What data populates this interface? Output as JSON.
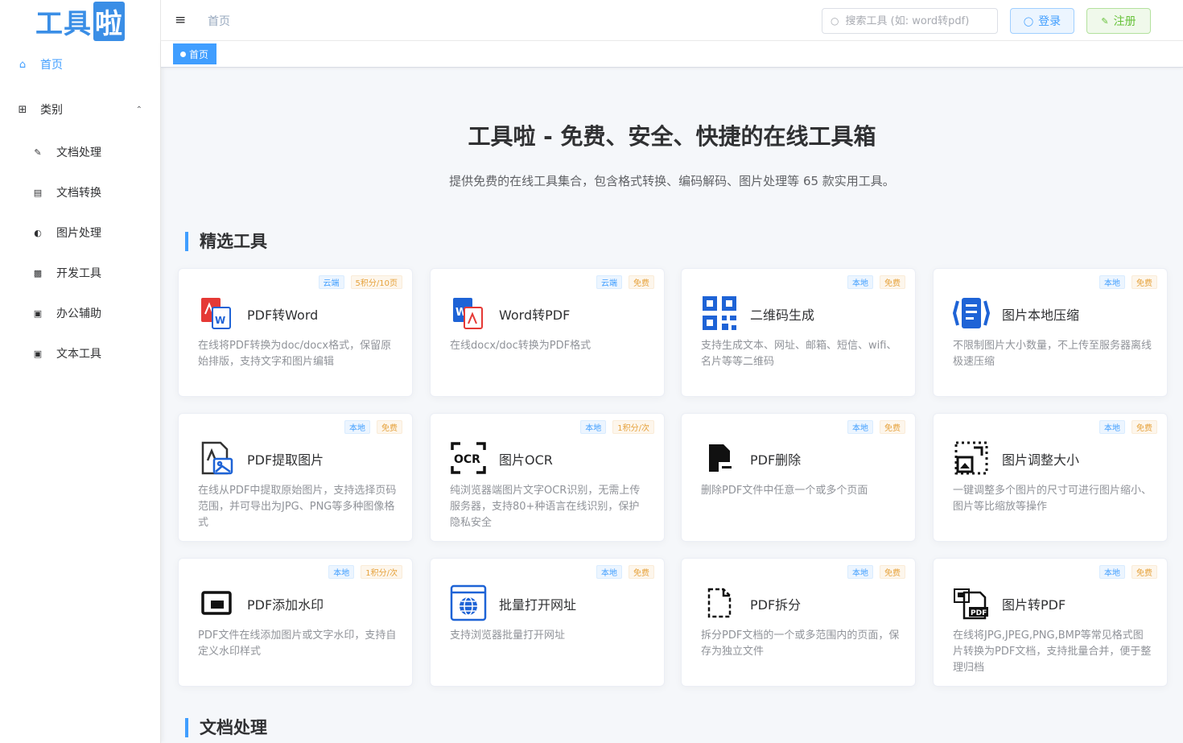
{
  "brand": {
    "logo_part1": "工具",
    "logo_part2": "啦"
  },
  "sidebar": {
    "home": "首页",
    "category": "类别",
    "items": [
      {
        "label": "文档处理",
        "icon": "edit-doc-icon"
      },
      {
        "label": "文档转换",
        "icon": "file-convert-icon"
      },
      {
        "label": "图片处理",
        "icon": "image-icon"
      },
      {
        "label": "开发工具",
        "icon": "dev-icon"
      },
      {
        "label": "办公辅助",
        "icon": "briefcase-icon"
      },
      {
        "label": "文本工具",
        "icon": "text-icon"
      }
    ]
  },
  "header": {
    "breadcrumb": "首页",
    "search_placeholder": "搜索工具 (如: word转pdf)",
    "login": "登录",
    "register": "注册"
  },
  "tags": {
    "home": "首页"
  },
  "hero": {
    "title": "工具啦 - 免费、安全、快捷的在线工具箱",
    "subtitle": "提供免费的在线工具集合，包含格式转换、编码解码、图片处理等 65 款实用工具。"
  },
  "sections": {
    "featured": "精选工具",
    "doc_processing": "文档处理"
  },
  "cards": [
    {
      "title": "PDF转Word",
      "desc": "在线将PDF转换为doc/docx格式，保留原始排版，支持文字和图片编辑",
      "badges": [
        "云端",
        "5积分/10页"
      ],
      "icon": "pdf-to-word-icon"
    },
    {
      "title": "Word转PDF",
      "desc": "在线docx/doc转换为PDF格式",
      "badges": [
        "云端",
        "免费"
      ],
      "icon": "word-to-pdf-icon"
    },
    {
      "title": "二维码生成",
      "desc": "支持生成文本、网址、邮箱、短信、wifi、名片等等二维码",
      "badges": [
        "本地",
        "免费"
      ],
      "icon": "qrcode-icon"
    },
    {
      "title": "图片本地压缩",
      "desc": "不限制图片大小数量，不上传至服务器离线极速压缩",
      "badges": [
        "本地",
        "免费"
      ],
      "icon": "compress-icon"
    },
    {
      "title": "PDF提取图片",
      "desc": "在线从PDF中提取原始图片，支持选择页码范围，并可导出为JPG、PNG等多种图像格式",
      "badges": [
        "本地",
        "免费"
      ],
      "icon": "pdf-extract-image-icon"
    },
    {
      "title": "图片OCR",
      "desc": "纯浏览器端图片文字OCR识别，无需上传服务器，支持80+种语言在线识别，保护隐私安全",
      "badges": [
        "本地",
        "1积分/次"
      ],
      "icon": "ocr-icon"
    },
    {
      "title": "PDF删除",
      "desc": "删除PDF文件中任意一个或多个页面",
      "badges": [
        "本地",
        "免费"
      ],
      "icon": "pdf-delete-icon"
    },
    {
      "title": "图片调整大小",
      "desc": "一键调整多个图片的尺寸可进行图片缩小、图片等比缩放等操作",
      "badges": [
        "本地",
        "免费"
      ],
      "icon": "resize-icon"
    },
    {
      "title": "PDF添加水印",
      "desc": "PDF文件在线添加图片或文字水印，支持自定义水印样式",
      "badges": [
        "本地",
        "1积分/次"
      ],
      "icon": "watermark-icon"
    },
    {
      "title": "批量打开网址",
      "desc": "支持浏览器批量打开网址",
      "badges": [
        "本地",
        "免费"
      ],
      "icon": "globe-icon"
    },
    {
      "title": "PDF拆分",
      "desc": "拆分PDF文档的一个或多范围内的页面，保存为独立文件",
      "badges": [
        "本地",
        "免费"
      ],
      "icon": "pdf-split-icon"
    },
    {
      "title": "图片转PDF",
      "desc": "在线将JPG,JPEG,PNG,BMP等常见格式图片转换为PDF文档，支持批量合并，便于整理归档",
      "badges": [
        "本地",
        "免费"
      ],
      "icon": "image-to-pdf-icon"
    }
  ],
  "colors": {
    "primary": "#409eff",
    "success": "#67c23a",
    "warning": "#e6a23c"
  }
}
